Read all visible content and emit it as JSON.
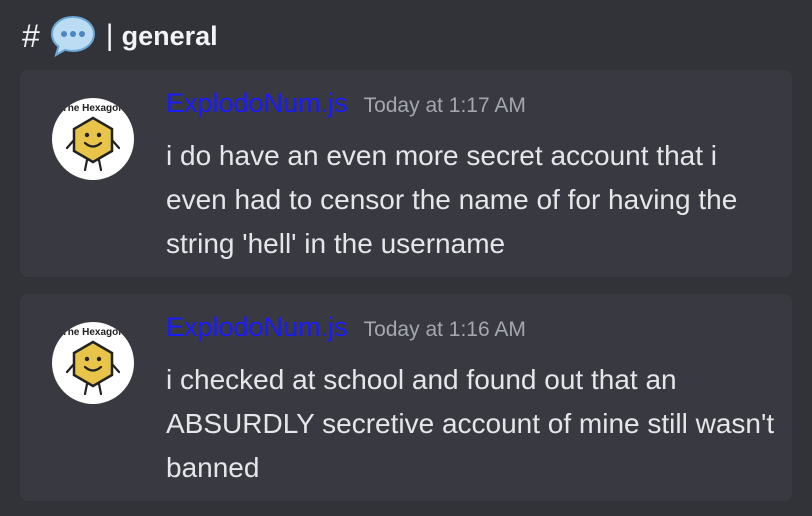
{
  "channel": {
    "hash": "#",
    "separator": "|",
    "name": "general",
    "icon": "speech-bubble-icon"
  },
  "messages": [
    {
      "author": "ExplodoNum.js",
      "timestamp": "Today at 1:17 AM",
      "text": "i do have an even more secret account that i even had to censor the name of for having the string 'hell' in the username",
      "avatar_caption": "The Hexagon"
    },
    {
      "author": "ExplodoNum.js",
      "timestamp": "Today at 1:16 AM",
      "text": "i checked at school and found out that an ABSURDLY secretive account of mine still wasn't banned",
      "avatar_caption": "The Hexagon"
    }
  ],
  "colors": {
    "background": "#323339",
    "message_card": "#393a41",
    "author_name": "#1a1aff",
    "timestamp": "#a4a7ae",
    "hexagon_fill": "#e8c44a"
  }
}
